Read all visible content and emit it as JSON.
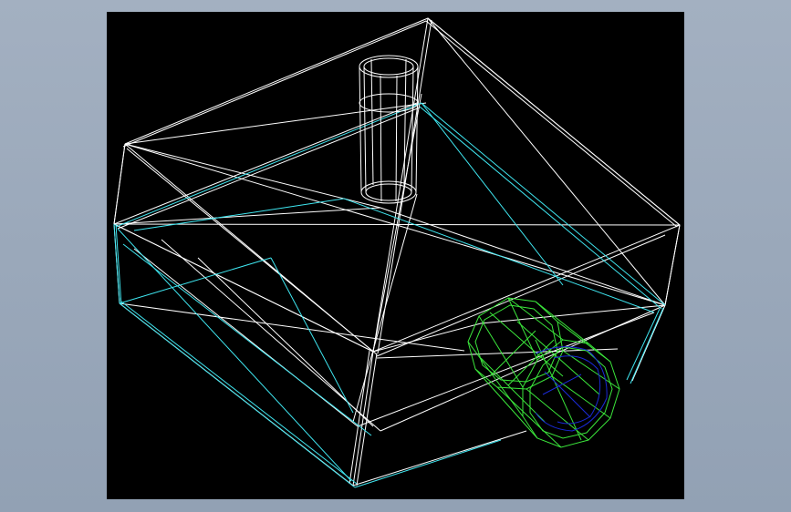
{
  "scene": {
    "view_mode": "wireframe",
    "background_color": "#000000",
    "window_background_color": "#9aa8ba",
    "objects": [
      {
        "name": "box-body",
        "edge_color": "#ffffff"
      },
      {
        "name": "box-lower-edges",
        "edge_color": "#3fe6f0"
      },
      {
        "name": "top-pipe",
        "edge_color": "#ffffff"
      },
      {
        "name": "side-cylinder",
        "edge_color": "#3be63b"
      },
      {
        "name": "side-cylinder-inner",
        "edge_color": "#1a2ad6"
      }
    ]
  }
}
